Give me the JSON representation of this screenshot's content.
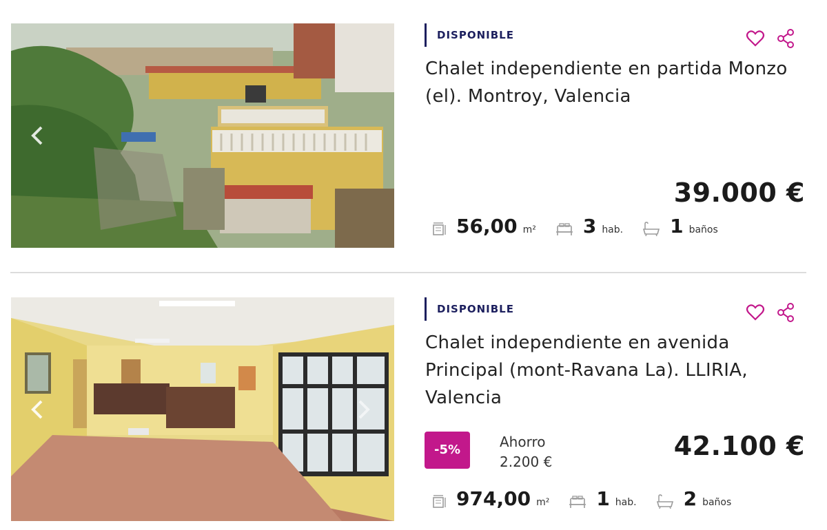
{
  "listings": [
    {
      "status": "DISPONIBLE",
      "title": "Chalet independiente en partida Monzo (el). Montroy, Valencia",
      "price": "39.000 €",
      "area": "56,00",
      "area_unit": "m²",
      "rooms": "3",
      "rooms_unit": "hab.",
      "baths": "1",
      "baths_unit": "baños"
    },
    {
      "status": "DISPONIBLE",
      "title": "Chalet independiente en avenida Principal (mont-Ravana La). LLIRIA, Valencia",
      "price": "42.100 €",
      "discount": "-5%",
      "saving_label": "Ahorro",
      "saving_value": "2.200 €",
      "area": "974,00",
      "area_unit": "m²",
      "rooms": "1",
      "rooms_unit": "hab.",
      "baths": "2",
      "baths_unit": "baños"
    }
  ],
  "colors": {
    "accent": "#c2188b",
    "status_bar": "#1c1f5e",
    "icon_grey": "#9a9a9a"
  },
  "icons": [
    "heart-icon",
    "share-icon",
    "area-icon",
    "bed-icon",
    "bathtub-icon",
    "chevron-left-icon",
    "chevron-right-icon"
  ]
}
